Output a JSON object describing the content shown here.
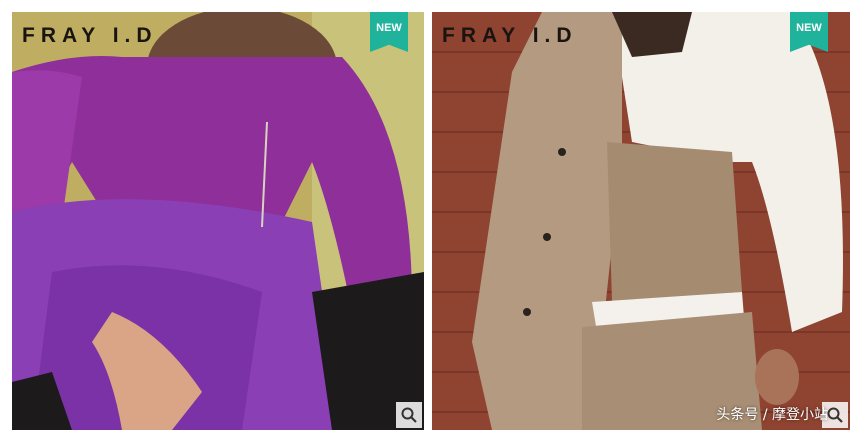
{
  "cards": [
    {
      "brand": "FRAY I.D",
      "badge": "NEW",
      "icon": "search-icon"
    },
    {
      "brand": "FRAY I.D",
      "badge": "NEW",
      "icon": "search-icon"
    }
  ],
  "watermark": "头条号 / 摩登小站",
  "colors": {
    "badge": "#1fb39b",
    "left_outfit": "#8e2f9a",
    "right_outfit": "#b49a80"
  }
}
